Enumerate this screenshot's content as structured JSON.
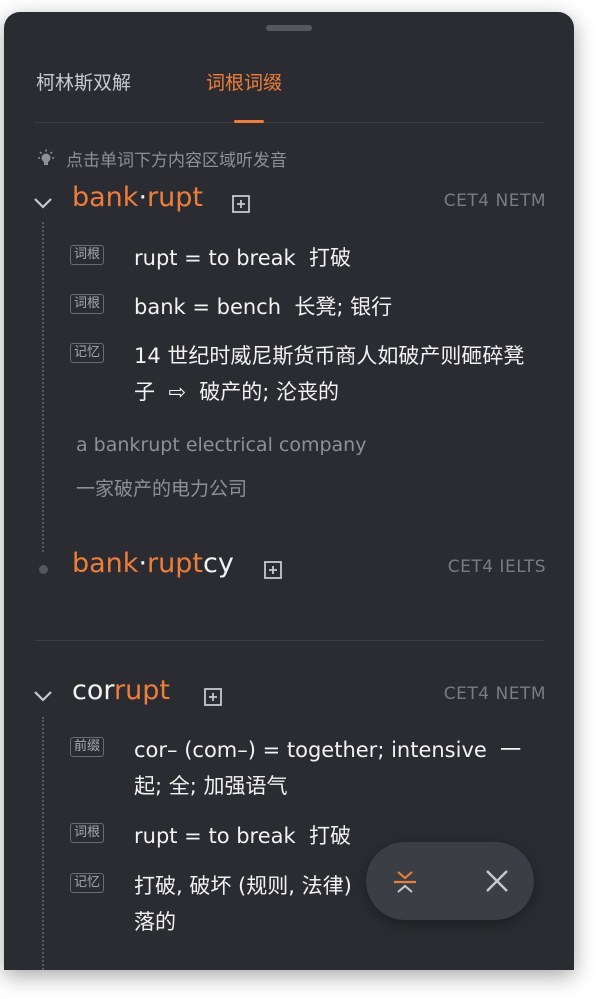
{
  "tabs": [
    {
      "label": "柯林斯双解",
      "active": false
    },
    {
      "label": "词根词缀",
      "active": true
    }
  ],
  "hint": "点击单词下方内容区域听发音",
  "colors": {
    "accent": "#ee7e3d",
    "background": "#2b2c31",
    "text": "#f2f2f2",
    "muted": "#8e9096"
  },
  "entries": [
    {
      "word_parts": [
        "bank",
        "·",
        "rupt"
      ],
      "tags": "CET4 NETM",
      "rows": [
        {
          "badge": "词根",
          "text": "rupt = to break  打破"
        },
        {
          "badge": "词根",
          "text": "bank = bench  长凳; 银行"
        },
        {
          "badge": "记忆",
          "text": "14 世纪时威尼斯货币商人如破产则砸碎凳子  ⇨  破产的; 沦丧的"
        }
      ],
      "example_en": "a bankrupt electrical company",
      "example_zh": "一家破产的电力公司"
    },
    {
      "word_parts": [
        "bank",
        "·",
        "rupt",
        "cy"
      ],
      "tags": "CET4 IELTS"
    },
    {
      "word_parts": [
        "cor",
        "rupt"
      ],
      "tags": "CET4 NETM",
      "rows": [
        {
          "badge": "前缀",
          "text": "cor– (com–) = together; intensive  一起; 全; 加强语气"
        },
        {
          "badge": "词根",
          "text": "rupt = to break  打破"
        },
        {
          "badge": "记忆",
          "text": "打破, 破坏 (规则, 法律)"
        },
        {
          "text_cont": "落的"
        }
      ]
    }
  ],
  "icons": {
    "hint": "lightbulb-icon",
    "expand": "chevron-down-icon",
    "add": "add-to-wordbook-icon",
    "collapse": "collapse-icon",
    "close": "close-icon"
  }
}
